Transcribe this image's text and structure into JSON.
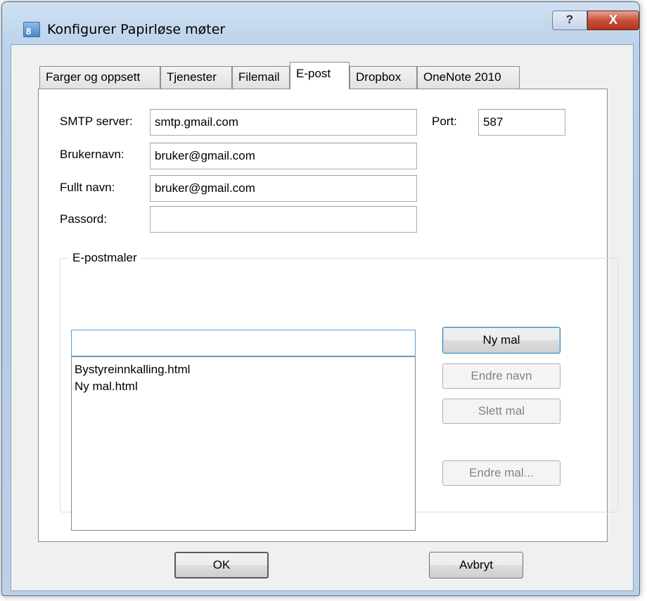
{
  "window": {
    "title": "Konfigurer Papirløse møter",
    "icon_glyph": "8",
    "help_glyph": "?",
    "close_glyph": "X"
  },
  "tabs": [
    {
      "label": "Farger og oppsett",
      "active": false
    },
    {
      "label": "Tjenester",
      "active": false
    },
    {
      "label": "Filemail",
      "active": false
    },
    {
      "label": "E-post",
      "active": true
    },
    {
      "label": "Dropbox",
      "active": false
    },
    {
      "label": "OneNote 2010",
      "active": false
    }
  ],
  "form": {
    "smtp_label": "SMTP server:",
    "smtp_value": "smtp.gmail.com",
    "port_label": "Port:",
    "port_value": "587",
    "username_label": "Brukernavn:",
    "username_value": "bruker@gmail.com",
    "fullname_label": "Fullt navn:",
    "fullname_value": "bruker@gmail.com",
    "password_label": "Passord:",
    "password_value": ""
  },
  "templates": {
    "group_title": "E-postmaler",
    "name_input_value": "",
    "items": [
      "Bystyreinnkalling.html",
      "Ny mal.html"
    ],
    "new_button": "Ny mal",
    "rename_button": "Endre navn",
    "delete_button": "Slett mal",
    "edit_button": "Endre mal..."
  },
  "footer": {
    "ok_button": "OK",
    "cancel_button": "Avbryt"
  }
}
